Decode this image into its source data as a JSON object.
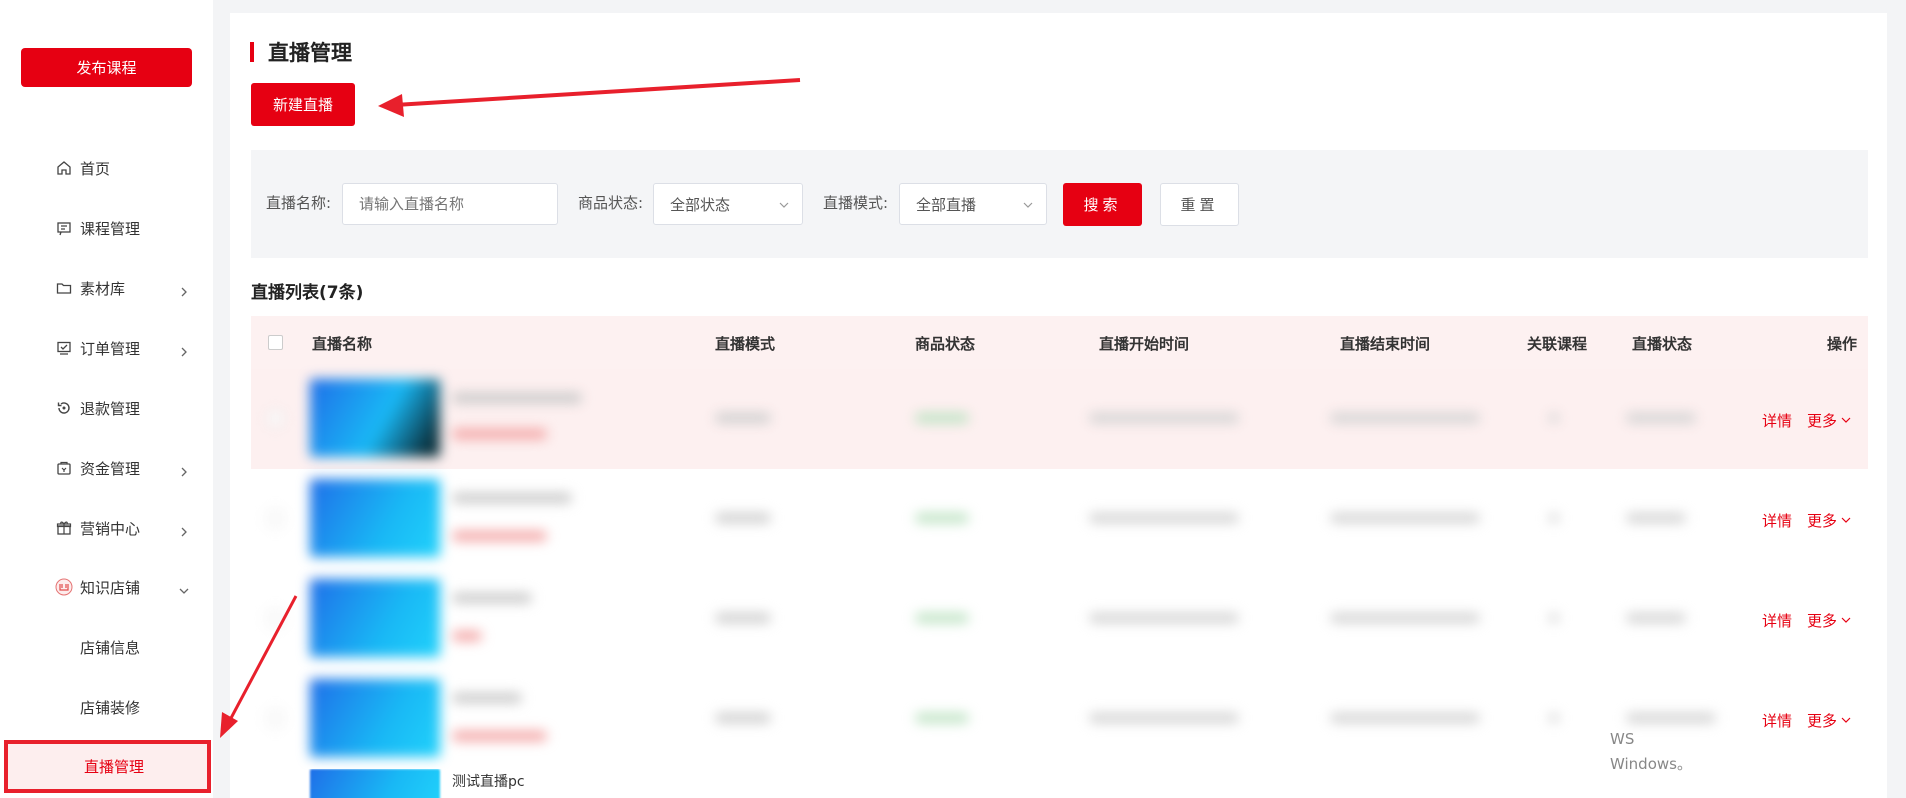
{
  "sidebar": {
    "publish_label": "发布课程",
    "items": [
      {
        "label": "首页",
        "icon": "home-icon"
      },
      {
        "label": "课程管理",
        "icon": "course-icon"
      },
      {
        "label": "素材库",
        "icon": "folder-icon"
      },
      {
        "label": "订单管理",
        "icon": "order-icon"
      },
      {
        "label": "退款管理",
        "icon": "refund-icon"
      },
      {
        "label": "资金管理",
        "icon": "wallet-icon"
      },
      {
        "label": "营销中心",
        "icon": "gift-icon"
      },
      {
        "label": "知识店铺",
        "icon": "shop-icon"
      }
    ],
    "sub_items": [
      {
        "label": "店铺信息"
      },
      {
        "label": "店铺装修"
      },
      {
        "label": "直播管理"
      }
    ]
  },
  "main": {
    "title": "直播管理",
    "new_button": "新建直播",
    "filter": {
      "name_label": "直播名称:",
      "name_placeholder": "请输入直播名称",
      "status_label": "商品状态:",
      "status_value": "全部状态",
      "mode_label": "直播模式:",
      "mode_value": "全部直播",
      "search_label": "搜索",
      "reset_label": "重置"
    },
    "list_title": "直播列表(7条)",
    "columns": [
      "直播名称",
      "直播模式",
      "商品状态",
      "直播开始时间",
      "直播结束时间",
      "关联课程",
      "直播状态",
      "操作"
    ],
    "row_actions": {
      "detail": "详情",
      "more": "更多"
    },
    "last_row_name": "测试直播pc"
  },
  "watermark": {
    "line1": "WS",
    "line2": "Windows。"
  },
  "colors": {
    "brand": "#e60012",
    "header_bg": "#fdf1f1",
    "filter_bg": "#f4f5f7"
  }
}
